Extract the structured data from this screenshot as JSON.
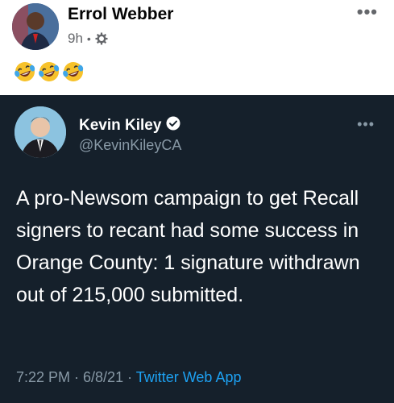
{
  "post": {
    "author": "Errol Webber",
    "time": "9h",
    "separator": "•",
    "privacy_icon": "gear-icon",
    "more_icon": "ellipsis-icon",
    "more_label": "•••",
    "reaction_emojis": [
      "laughing-crying-emoji",
      "laughing-crying-emoji",
      "laughing-crying-emoji"
    ]
  },
  "tweet": {
    "name": "Kevin Kiley",
    "verified_icon": "verified-badge-icon",
    "handle": "@KevinKileyCA",
    "more_label": "•••",
    "text": "A pro-Newsom campaign to get Recall signers to recant had some success in Orange County: 1 signature withdrawn out of 215,000 submitted.",
    "timestamp": "7:22 PM · 6/8/21 · ",
    "source": "Twitter Web App"
  },
  "colors": {
    "tweet_bg": "#15202b",
    "secondary_text": "#8899a6",
    "link": "#1da1f2",
    "fb_secondary": "#65676b"
  }
}
